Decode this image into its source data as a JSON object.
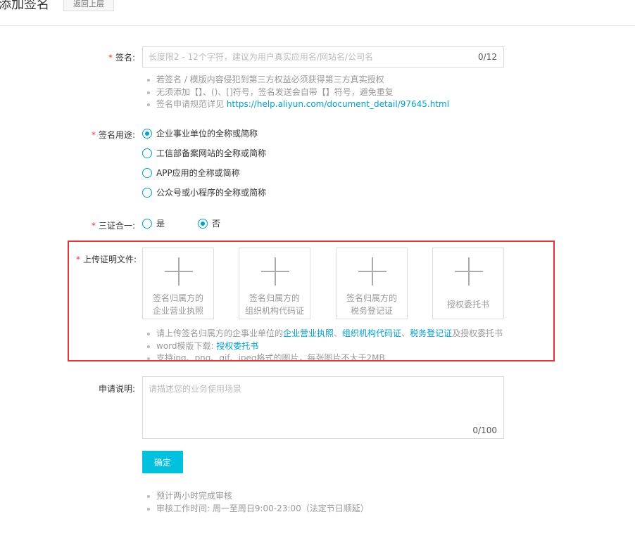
{
  "header": {
    "title": "添加签名",
    "back_label": "返回上层"
  },
  "signature": {
    "label": "签名:",
    "placeholder": "长度限2 - 12个字符，建议为用户真实应用名/网站名/公司名",
    "counter": "0/12",
    "notes": [
      "若签名 / 模版内容侵犯到第三方权益必须获得第三方真实授权",
      "无须添加【】、()、[]符号，签名发送会自带【】符号，避免重复"
    ],
    "note3_prefix": "签名申请规范详见 ",
    "note3_link": "https://help.aliyun.com/document_detail/97645.html"
  },
  "usage": {
    "label": "签名用途:",
    "options": [
      "企业事业单位的全称或简称",
      "工信部备案网站的全称或简称",
      "APP应用的全称或简称",
      "公众号或小程序的全称或简称"
    ],
    "selected_index": 0
  },
  "three_in_one": {
    "label": "三证合一:",
    "options": [
      "是",
      "否"
    ],
    "selected_index": 1
  },
  "upload": {
    "label": "上传证明文件:",
    "cards": [
      {
        "line1": "签名归属方的",
        "line2": "企业营业执照"
      },
      {
        "line1": "签名归属方的",
        "line2": "组织机构代码证"
      },
      {
        "line1": "签名归属方的",
        "line2": "税务登记证"
      },
      {
        "line1": "授权委托书",
        "line2": ""
      }
    ],
    "note1": {
      "prefix": "请上传签名归属方的企事业单位的",
      "link1": "企业营业执照",
      "sep1": "、",
      "link2": "组织机构代码证",
      "sep2": "、",
      "link3": "税务登记证",
      "suffix": "及授权委托书"
    },
    "note2": {
      "prefix": "word模版下载: ",
      "link": "授权委托书"
    },
    "note3": "支持jpg、png、gif、jpeg格式的图片，每张图片不大于2MB"
  },
  "description": {
    "label": "申请说明:",
    "placeholder": "请描述您的业务使用场景",
    "counter": "0/100"
  },
  "submit": {
    "label": "确定"
  },
  "footer_notes": [
    "预计两小时完成审核",
    "审核工作时间: 周一至周日9:00-23:00（法定节日顺延）"
  ],
  "colors": {
    "accent": "#00a2ca",
    "button": "#00c1de",
    "required": "#e4393c",
    "highlight_box": "#e0343a"
  }
}
